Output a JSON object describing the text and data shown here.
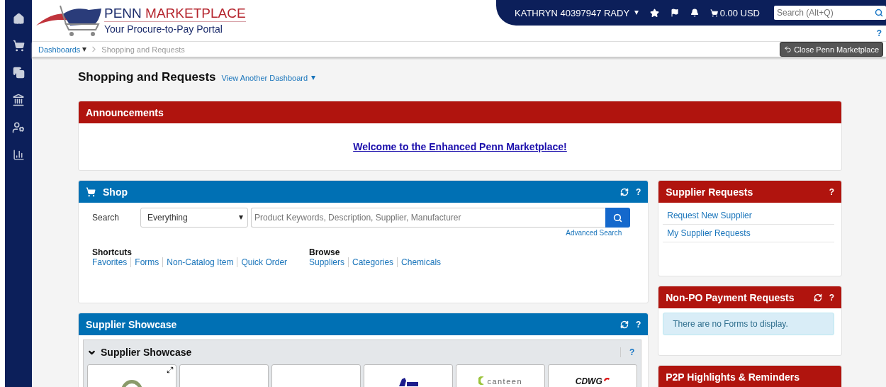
{
  "header": {
    "logo": {
      "name_1": "PENN",
      "name_2": "MARKETPLACE",
      "tagline": "Your Procure-to-Pay Portal"
    },
    "user": "KATHRYN 40397947 RADY",
    "cart_total": "0.00 USD",
    "search": {
      "placeholder": "Search (Alt+Q)"
    },
    "help": "?"
  },
  "breadcrumb": {
    "items": [
      "Dashboards",
      "Shopping and Requests"
    ],
    "close_button": "Close Penn Marketplace"
  },
  "page": {
    "title": "Shopping and Requests",
    "switch_link": "View Another Dashboard"
  },
  "announcements": {
    "title": "Announcements",
    "link": "Welcome to the Enhanced Penn Marketplace!"
  },
  "shop": {
    "title": "Shop",
    "refreshable": true,
    "help": "?",
    "search_label": "Search",
    "scope": "Everything",
    "placeholder": "Product Keywords, Description, Supplier, Manufacturer",
    "advanced_link": "Advanced Search",
    "groups": [
      {
        "title": "Shortcuts",
        "links": [
          "Favorites",
          "Forms",
          "Non-Catalog Item",
          "Quick Order"
        ]
      },
      {
        "title": "Browse",
        "links": [
          "Suppliers",
          "Categories",
          "Chemicals"
        ]
      }
    ]
  },
  "supplier_showcase": {
    "title": "Supplier Showcase",
    "refreshable": true,
    "help": "?",
    "section": {
      "title": "Supplier Showcase",
      "expanded": true,
      "help": "?"
    },
    "tiles": [
      {
        "kind": "seal"
      },
      {
        "kind": "blank"
      },
      {
        "kind": "blank"
      },
      {
        "kind": "bird"
      },
      {
        "kind": "canteen",
        "label": "canteen"
      },
      {
        "kind": "cdwg",
        "label": "CDWG"
      }
    ]
  },
  "side_panels": [
    {
      "title": "Supplier Requests",
      "refreshable": false,
      "help": "?",
      "links": [
        "Request New Supplier",
        "My Supplier Requests"
      ]
    },
    {
      "title": "Non-PO Payment Requests",
      "refreshable": true,
      "help": "?",
      "notice": "There are no Forms to display."
    },
    {
      "title": "P2P Highlights & Reminders",
      "refreshable": false
    }
  ]
}
